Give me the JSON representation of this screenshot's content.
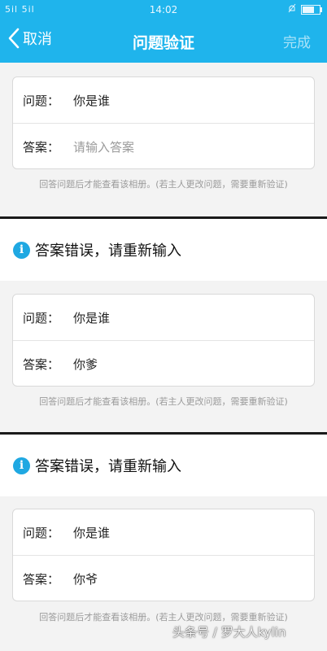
{
  "status_bar": {
    "signal": "5il 5il",
    "time": "14:02"
  },
  "nav": {
    "back_label": "取消",
    "title": "问题验证",
    "done_label": "完成"
  },
  "sections": [
    {
      "question_label": "问题：",
      "question_value": "你是谁",
      "answer_label": "答案：",
      "answer_placeholder": "请输入答案",
      "hint": "回答问题后才能查看该相册。(若主人更改问题，需要重新验证)"
    },
    {
      "error": "答案错误，请重新输入",
      "question_label": "问题：",
      "question_value": "你是谁",
      "answer_label": "答案：",
      "answer_value": "你爹",
      "hint": "回答问题后才能查看该相册。(若主人更改问题，需要重新验证)"
    },
    {
      "error": "答案错误，请重新输入",
      "question_label": "问题：",
      "question_value": "你是谁",
      "answer_label": "答案：",
      "answer_value": "你爷",
      "hint": "回答问题后才能查看该相册。(若主人更改问题，需要重新验证)"
    }
  ],
  "watermark": "头条号 / 罗大人kylin",
  "colors": {
    "header": "#1fb4ec",
    "info_icon": "#1fa8e2",
    "placeholder": "#9a9a9a"
  }
}
